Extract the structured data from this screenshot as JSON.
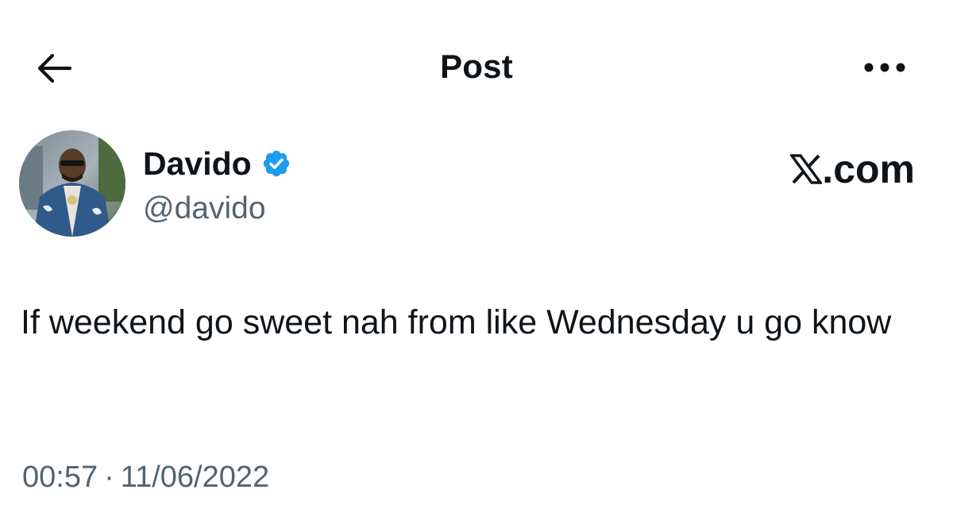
{
  "header": {
    "title": "Post",
    "back_icon": "arrow-left-icon",
    "more_icon": "more-horizontal-icon"
  },
  "author": {
    "display_name": "Davido",
    "handle": "@davido",
    "verified": true,
    "verified_color": "#1d9bf0"
  },
  "watermark": {
    "text": ".com",
    "logo": "x-logo-icon"
  },
  "post": {
    "text": "If weekend go sweet nah from like Wednesday u go know"
  },
  "meta": {
    "time": "00:57",
    "separator": "·",
    "date": "11/06/2022"
  },
  "colors": {
    "text": "#0f1419",
    "secondary": "#536471",
    "background": "#ffffff"
  }
}
